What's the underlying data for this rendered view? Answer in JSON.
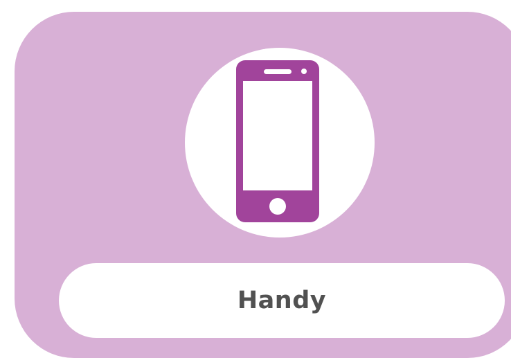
{
  "tile": {
    "icon": "smartphone-icon",
    "label": "Handy"
  },
  "colors": {
    "card_background": "#d8b0d6",
    "icon_fill": "#a1449b",
    "label_text": "#515151",
    "surface": "#ffffff"
  }
}
